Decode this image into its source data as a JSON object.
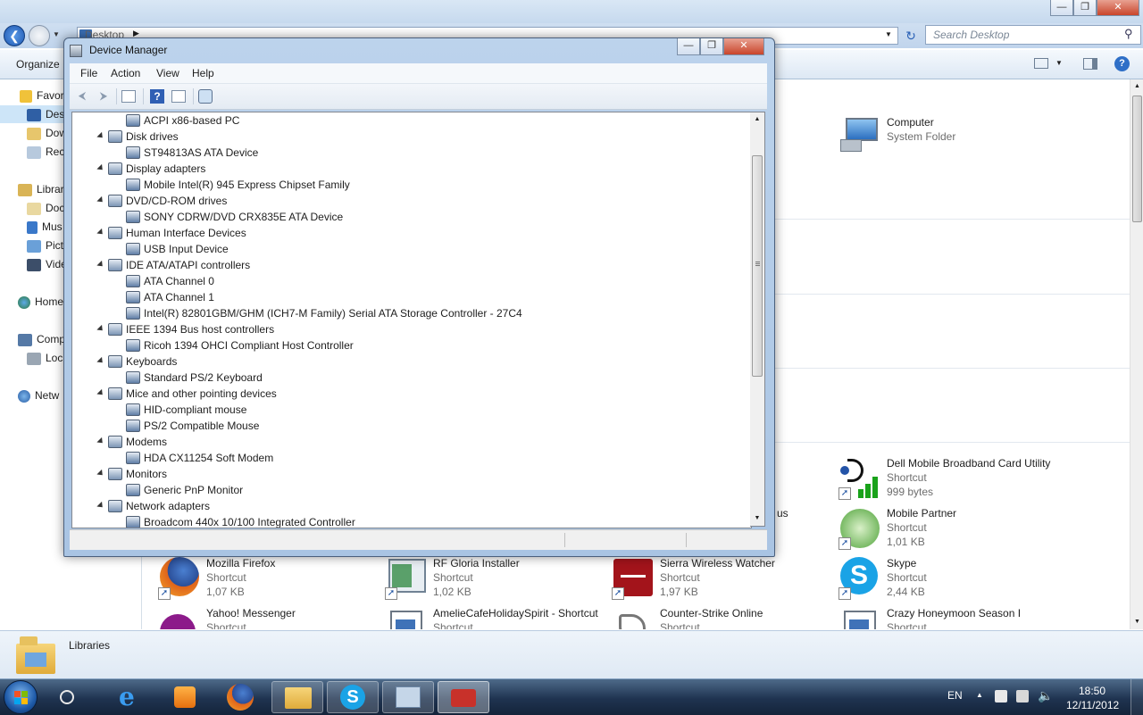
{
  "explorer": {
    "address": "Desktop",
    "search_placeholder": "Search Desktop",
    "organize_label": "Organize",
    "nav": {
      "favorites": "Favor",
      "desktop": "Des",
      "downloads": "Dow",
      "recent": "Rec",
      "libraries": "Librar",
      "documents": "Doc",
      "music": "Mus",
      "pictures": "Pict",
      "videos": "Vide",
      "homegroup": "Home",
      "computer": "Comp",
      "local_disk": "Loc",
      "network": "Netw"
    },
    "tiles": {
      "computer": {
        "name": "Computer",
        "type": "System Folder"
      },
      "dell": {
        "name": "Dell Mobile Broadband Card Utility",
        "type": "Shortcut",
        "size": "999 bytes"
      },
      "mobile_partner": {
        "name": "Mobile Partner",
        "type": "Shortcut",
        "size": "1,01 KB"
      },
      "firefox": {
        "name": "Mozilla Firefox",
        "type": "Shortcut",
        "size": "1,07 KB"
      },
      "rf_gloria": {
        "name": "RF Gloria Installer",
        "type": "Shortcut",
        "size": "1,02 KB"
      },
      "sierra": {
        "name": "Sierra Wireless Watcher",
        "type": "Shortcut",
        "size": "1,97 KB"
      },
      "skype": {
        "name": "Skype",
        "type": "Shortcut",
        "size": "2,44 KB"
      },
      "yahoo": {
        "name": "Yahoo! Messenger",
        "type": "Shortcut"
      },
      "amelie": {
        "name": "AmelieCafeHolidaySpirit - Shortcut",
        "type": "Shortcut"
      },
      "counter_strike": {
        "name": "Counter-Strike Online",
        "type": "Shortcut"
      },
      "crazy_honeymoon": {
        "name": "Crazy Honeymoon Season I",
        "type": "Shortcut"
      },
      "partial_us": "us"
    },
    "details_name": "Libraries"
  },
  "device_manager": {
    "title": "Device Manager",
    "menu": [
      "File",
      "Action",
      "View",
      "Help"
    ],
    "tree": [
      {
        "text": "ACPI x86-based PC",
        "level": 2
      },
      {
        "text": "Disk drives",
        "level": 1
      },
      {
        "text": "ST94813AS ATA Device",
        "level": 2
      },
      {
        "text": "Display adapters",
        "level": 1
      },
      {
        "text": "Mobile Intel(R) 945 Express Chipset Family",
        "level": 2
      },
      {
        "text": "DVD/CD-ROM drives",
        "level": 1
      },
      {
        "text": "SONY CDRW/DVD CRX835E ATA Device",
        "level": 2
      },
      {
        "text": "Human Interface Devices",
        "level": 1
      },
      {
        "text": "USB Input Device",
        "level": 2
      },
      {
        "text": "IDE ATA/ATAPI controllers",
        "level": 1
      },
      {
        "text": "ATA Channel 0",
        "level": 2
      },
      {
        "text": "ATA Channel 1",
        "level": 2
      },
      {
        "text": "Intel(R) 82801GBM/GHM (ICH7-M Family) Serial ATA Storage Controller - 27C4",
        "level": 2
      },
      {
        "text": "IEEE 1394 Bus host controllers",
        "level": 1
      },
      {
        "text": "Ricoh 1394 OHCI Compliant Host Controller",
        "level": 2
      },
      {
        "text": "Keyboards",
        "level": 1
      },
      {
        "text": "Standard PS/2 Keyboard",
        "level": 2
      },
      {
        "text": "Mice and other pointing devices",
        "level": 1
      },
      {
        "text": "HID-compliant mouse",
        "level": 2
      },
      {
        "text": "PS/2 Compatible Mouse",
        "level": 2
      },
      {
        "text": "Modems",
        "level": 1
      },
      {
        "text": "HDA CX11254 Soft Modem",
        "level": 2
      },
      {
        "text": "Monitors",
        "level": 1
      },
      {
        "text": "Generic PnP Monitor",
        "level": 2
      },
      {
        "text": "Network adapters",
        "level": 1
      },
      {
        "text": "Broadcom 440x 10/100 Integrated Controller",
        "level": 2
      }
    ]
  },
  "taskbar": {
    "language": "EN",
    "time": "18:50",
    "date": "12/11/2012"
  },
  "colors": {
    "taskbar": "#1f3350",
    "title_glass": "#bcd3ec",
    "tree_line": "#333333"
  }
}
